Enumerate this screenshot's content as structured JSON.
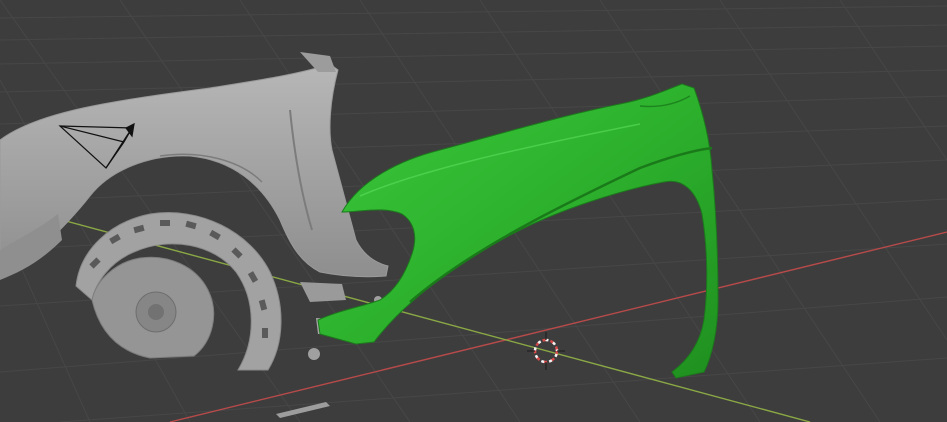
{
  "viewport": {
    "background_color": "#3d3d3d",
    "grid_color": "#4a4a4a",
    "x_axis_color": "#b84a4a",
    "y_axis_color": "#8aa845",
    "mesh_color": "#a9a9a9",
    "fender_color": "#2db12d",
    "cursor_color": "#d84a4a"
  },
  "objects": {
    "scan_mesh": "car-body-scan",
    "fender": "fender-model",
    "camera": "camera-icon",
    "cursor": "3d-cursor-icon"
  }
}
